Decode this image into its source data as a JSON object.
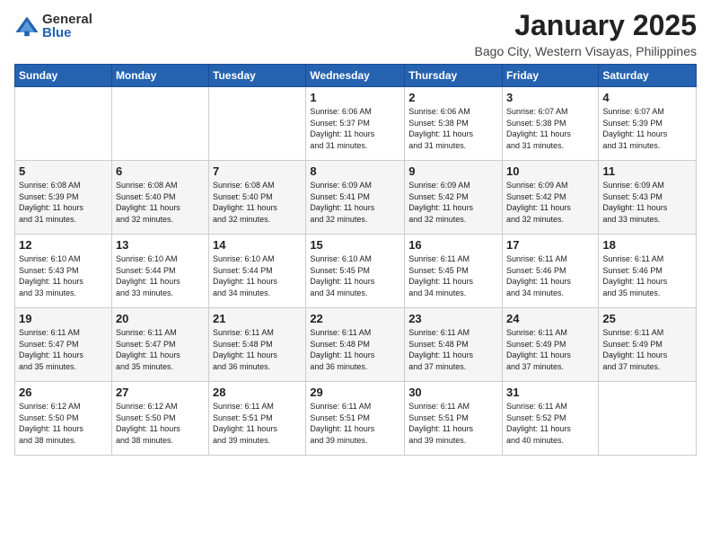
{
  "logo": {
    "general": "General",
    "blue": "Blue"
  },
  "header": {
    "title": "January 2025",
    "subtitle": "Bago City, Western Visayas, Philippines"
  },
  "weekdays": [
    "Sunday",
    "Monday",
    "Tuesday",
    "Wednesday",
    "Thursday",
    "Friday",
    "Saturday"
  ],
  "weeks": [
    [
      {
        "day": "",
        "info": ""
      },
      {
        "day": "",
        "info": ""
      },
      {
        "day": "",
        "info": ""
      },
      {
        "day": "1",
        "info": "Sunrise: 6:06 AM\nSunset: 5:37 PM\nDaylight: 11 hours\nand 31 minutes."
      },
      {
        "day": "2",
        "info": "Sunrise: 6:06 AM\nSunset: 5:38 PM\nDaylight: 11 hours\nand 31 minutes."
      },
      {
        "day": "3",
        "info": "Sunrise: 6:07 AM\nSunset: 5:38 PM\nDaylight: 11 hours\nand 31 minutes."
      },
      {
        "day": "4",
        "info": "Sunrise: 6:07 AM\nSunset: 5:39 PM\nDaylight: 11 hours\nand 31 minutes."
      }
    ],
    [
      {
        "day": "5",
        "info": "Sunrise: 6:08 AM\nSunset: 5:39 PM\nDaylight: 11 hours\nand 31 minutes."
      },
      {
        "day": "6",
        "info": "Sunrise: 6:08 AM\nSunset: 5:40 PM\nDaylight: 11 hours\nand 32 minutes."
      },
      {
        "day": "7",
        "info": "Sunrise: 6:08 AM\nSunset: 5:40 PM\nDaylight: 11 hours\nand 32 minutes."
      },
      {
        "day": "8",
        "info": "Sunrise: 6:09 AM\nSunset: 5:41 PM\nDaylight: 11 hours\nand 32 minutes."
      },
      {
        "day": "9",
        "info": "Sunrise: 6:09 AM\nSunset: 5:42 PM\nDaylight: 11 hours\nand 32 minutes."
      },
      {
        "day": "10",
        "info": "Sunrise: 6:09 AM\nSunset: 5:42 PM\nDaylight: 11 hours\nand 32 minutes."
      },
      {
        "day": "11",
        "info": "Sunrise: 6:09 AM\nSunset: 5:43 PM\nDaylight: 11 hours\nand 33 minutes."
      }
    ],
    [
      {
        "day": "12",
        "info": "Sunrise: 6:10 AM\nSunset: 5:43 PM\nDaylight: 11 hours\nand 33 minutes."
      },
      {
        "day": "13",
        "info": "Sunrise: 6:10 AM\nSunset: 5:44 PM\nDaylight: 11 hours\nand 33 minutes."
      },
      {
        "day": "14",
        "info": "Sunrise: 6:10 AM\nSunset: 5:44 PM\nDaylight: 11 hours\nand 34 minutes."
      },
      {
        "day": "15",
        "info": "Sunrise: 6:10 AM\nSunset: 5:45 PM\nDaylight: 11 hours\nand 34 minutes."
      },
      {
        "day": "16",
        "info": "Sunrise: 6:11 AM\nSunset: 5:45 PM\nDaylight: 11 hours\nand 34 minutes."
      },
      {
        "day": "17",
        "info": "Sunrise: 6:11 AM\nSunset: 5:46 PM\nDaylight: 11 hours\nand 34 minutes."
      },
      {
        "day": "18",
        "info": "Sunrise: 6:11 AM\nSunset: 5:46 PM\nDaylight: 11 hours\nand 35 minutes."
      }
    ],
    [
      {
        "day": "19",
        "info": "Sunrise: 6:11 AM\nSunset: 5:47 PM\nDaylight: 11 hours\nand 35 minutes."
      },
      {
        "day": "20",
        "info": "Sunrise: 6:11 AM\nSunset: 5:47 PM\nDaylight: 11 hours\nand 35 minutes."
      },
      {
        "day": "21",
        "info": "Sunrise: 6:11 AM\nSunset: 5:48 PM\nDaylight: 11 hours\nand 36 minutes."
      },
      {
        "day": "22",
        "info": "Sunrise: 6:11 AM\nSunset: 5:48 PM\nDaylight: 11 hours\nand 36 minutes."
      },
      {
        "day": "23",
        "info": "Sunrise: 6:11 AM\nSunset: 5:48 PM\nDaylight: 11 hours\nand 37 minutes."
      },
      {
        "day": "24",
        "info": "Sunrise: 6:11 AM\nSunset: 5:49 PM\nDaylight: 11 hours\nand 37 minutes."
      },
      {
        "day": "25",
        "info": "Sunrise: 6:11 AM\nSunset: 5:49 PM\nDaylight: 11 hours\nand 37 minutes."
      }
    ],
    [
      {
        "day": "26",
        "info": "Sunrise: 6:12 AM\nSunset: 5:50 PM\nDaylight: 11 hours\nand 38 minutes."
      },
      {
        "day": "27",
        "info": "Sunrise: 6:12 AM\nSunset: 5:50 PM\nDaylight: 11 hours\nand 38 minutes."
      },
      {
        "day": "28",
        "info": "Sunrise: 6:11 AM\nSunset: 5:51 PM\nDaylight: 11 hours\nand 39 minutes."
      },
      {
        "day": "29",
        "info": "Sunrise: 6:11 AM\nSunset: 5:51 PM\nDaylight: 11 hours\nand 39 minutes."
      },
      {
        "day": "30",
        "info": "Sunrise: 6:11 AM\nSunset: 5:51 PM\nDaylight: 11 hours\nand 39 minutes."
      },
      {
        "day": "31",
        "info": "Sunrise: 6:11 AM\nSunset: 5:52 PM\nDaylight: 11 hours\nand 40 minutes."
      },
      {
        "day": "",
        "info": ""
      }
    ]
  ]
}
